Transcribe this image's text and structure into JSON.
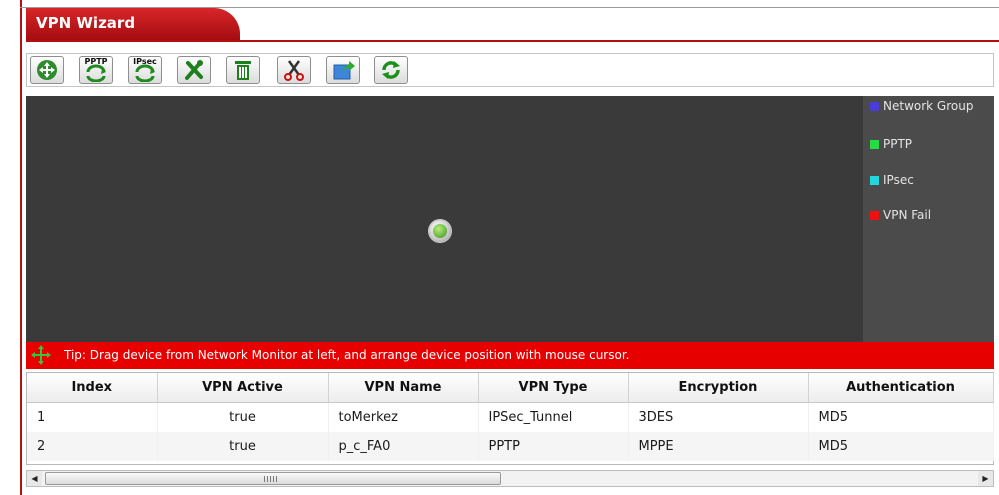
{
  "window": {
    "title": "VPN Wizard"
  },
  "toolbar": {
    "buttons": [
      {
        "name": "add-network-group",
        "icon": "move-arrows-icon"
      },
      {
        "name": "add-pptp",
        "icon": "pptp-icon",
        "label": "PPTP"
      },
      {
        "name": "add-ipsec",
        "icon": "ipsec-icon",
        "label": "IPsec"
      },
      {
        "name": "edit",
        "icon": "tools-icon"
      },
      {
        "name": "delete",
        "icon": "trash-icon"
      },
      {
        "name": "cut",
        "icon": "scissors-icon"
      },
      {
        "name": "export",
        "icon": "export-icon"
      },
      {
        "name": "refresh",
        "icon": "refresh-icon"
      }
    ]
  },
  "legend": {
    "items": [
      {
        "label": "Network Group",
        "color": "#4a3cd6"
      },
      {
        "label": "PPTP",
        "color": "#22dd44"
      },
      {
        "label": "IPsec",
        "color": "#22d8dd"
      },
      {
        "label": "VPN Fail",
        "color": "#ee1111"
      }
    ]
  },
  "tip": {
    "text": "Tip: Drag device from Network Monitor at left, and arrange device position with mouse cursor."
  },
  "table": {
    "columns": [
      "Index",
      "VPN Active",
      "VPN Name",
      "VPN Type",
      "Encryption",
      "Authentication"
    ],
    "rows": [
      [
        "1",
        "true",
        "toMerkez",
        "IPSec_Tunnel",
        "3DES",
        "MD5"
      ],
      [
        "2",
        "true",
        "p_c_FA0",
        "PPTP",
        "MPPE",
        "MD5"
      ]
    ]
  },
  "colors": {
    "accent": "#e60000",
    "canvas": "#3a3a3a",
    "legend_bg": "#4b4b4b"
  }
}
